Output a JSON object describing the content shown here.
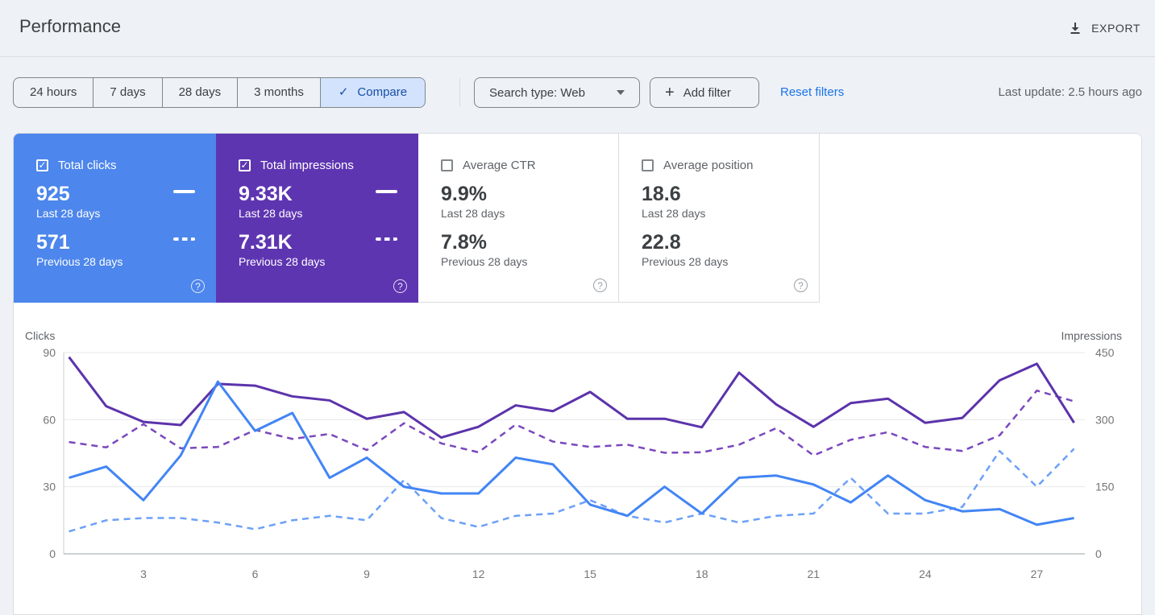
{
  "header": {
    "title": "Performance",
    "export_label": "EXPORT"
  },
  "filters": {
    "date_ranges": [
      "24 hours",
      "7 days",
      "28 days",
      "3 months"
    ],
    "compare_label": "Compare",
    "search_type": "Search type: Web",
    "add_filter": "Add filter",
    "reset_filters": "Reset filters",
    "last_update": "Last update: 2.5 hours ago"
  },
  "metrics": [
    {
      "label": "Total clicks",
      "checked": true,
      "color": "#4d86ec",
      "value_current": "925",
      "period_current": "Last 28 days",
      "value_previous": "571",
      "period_previous": "Previous 28 days"
    },
    {
      "label": "Total impressions",
      "checked": true,
      "color": "#5e35b1",
      "value_current": "9.33K",
      "period_current": "Last 28 days",
      "value_previous": "7.31K",
      "period_previous": "Previous 28 days"
    },
    {
      "label": "Average CTR",
      "checked": false,
      "value_current": "9.9%",
      "period_current": "Last 28 days",
      "value_previous": "7.8%",
      "period_previous": "Previous 28 days"
    },
    {
      "label": "Average position",
      "checked": false,
      "value_current": "18.6",
      "period_current": "Last 28 days",
      "value_previous": "22.8",
      "period_previous": "Previous 28 days"
    }
  ],
  "chart_data": {
    "type": "line",
    "x": [
      1,
      2,
      3,
      4,
      5,
      6,
      7,
      8,
      9,
      10,
      11,
      12,
      13,
      14,
      15,
      16,
      17,
      18,
      19,
      20,
      21,
      22,
      23,
      24,
      25,
      26,
      27,
      28
    ],
    "x_tick_labels": [
      3,
      6,
      9,
      12,
      15,
      18,
      21,
      24,
      27
    ],
    "grid": true,
    "legend_position": "none",
    "left_axis": {
      "label": "Clicks",
      "ticks": [
        0,
        30,
        60,
        90
      ],
      "max": 90
    },
    "right_axis": {
      "label": "Impressions",
      "ticks": [
        0,
        150,
        300,
        450
      ],
      "max": 450
    },
    "series": [
      {
        "name": "Clicks - Last 28 days",
        "axis": "left",
        "style": "solid",
        "color": "#4285f4",
        "values": [
          34,
          39,
          24,
          44,
          77,
          55,
          63,
          34,
          43,
          30,
          27,
          27,
          43,
          40,
          22,
          17,
          30,
          18,
          34,
          35,
          31,
          23,
          35,
          24,
          19,
          20,
          13,
          16
        ]
      },
      {
        "name": "Clicks - Previous 28 days",
        "axis": "left",
        "style": "dashed",
        "color": "#6ca0f8",
        "values": [
          10,
          15,
          16,
          16,
          14,
          11,
          15,
          17,
          15,
          33,
          16,
          12,
          17,
          18,
          24,
          17,
          14,
          18,
          14,
          17,
          18,
          34,
          18,
          18,
          21,
          46,
          30,
          47
        ]
      },
      {
        "name": "Impressions - Last 28 days",
        "axis": "right",
        "style": "solid",
        "color": "#5c33ab",
        "values": [
          440,
          330,
          295,
          288,
          380,
          376,
          352,
          343,
          302,
          317,
          260,
          284,
          332,
          319,
          362,
          302,
          302,
          283,
          405,
          334,
          284,
          337,
          347,
          293,
          304,
          388,
          425,
          293
        ]
      },
      {
        "name": "Impressions - Previous 28 days",
        "axis": "right",
        "style": "dashed",
        "color": "#7a48be",
        "values": [
          250,
          238,
          290,
          236,
          239,
          277,
          257,
          268,
          232,
          292,
          247,
          227,
          289,
          251,
          239,
          244,
          226,
          227,
          244,
          281,
          220,
          255,
          272,
          239,
          230,
          265,
          365,
          341
        ]
      }
    ]
  }
}
